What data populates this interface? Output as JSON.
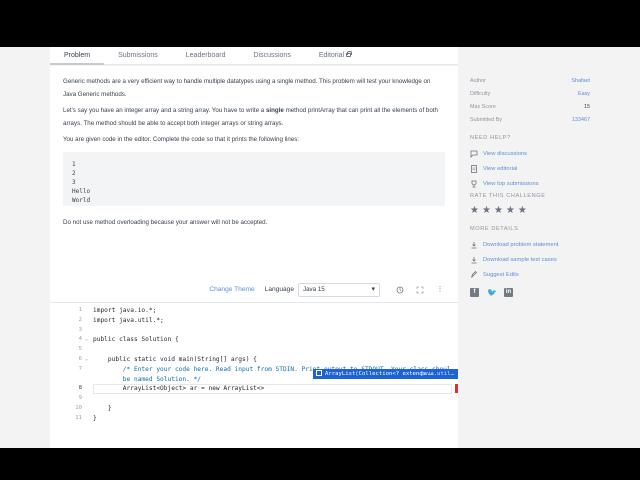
{
  "tabs": [
    {
      "label": "Problem"
    },
    {
      "label": "Submissions"
    },
    {
      "label": "Leaderboard"
    },
    {
      "label": "Discussions"
    },
    {
      "label": "Editorial"
    }
  ],
  "problem": {
    "para1": "Generic methods are a very efficient way to handle multiple datatypes using a single method. This problem will test your knowledge on Java Generic methods.",
    "para2_a": "Let's say you have an integer array and a string array. You have to write a ",
    "para2_b": "single",
    "para2_c": " method printArray that can print all the elements of both arrays. The method should be able to accept both integer arrays or string arrays.",
    "para3": "You are given code in the editor. Complete the code so that it prints the following lines:",
    "sample_lines": [
      "1",
      "2",
      "3",
      "Hello",
      "World"
    ],
    "para4": "Do not use method overloading because your answer will not be accepted."
  },
  "sidebar": {
    "meta": [
      {
        "key": "Author",
        "value": "Shafaet"
      },
      {
        "key": "Difficulty",
        "value": "Easy"
      },
      {
        "key": "Max Score",
        "value": "15"
      },
      {
        "key": "Submitted By",
        "value": "133467"
      }
    ],
    "need_help": "NEED HELP?",
    "help_links": [
      {
        "label": "View discussions",
        "icon": "chat-icon"
      },
      {
        "label": "View editorial",
        "icon": "document-icon"
      },
      {
        "label": "View top submissions",
        "icon": "trophy-icon"
      }
    ],
    "rate_label": "RATE THIS CHALLENGE",
    "rating": 5,
    "more_details": "MORE DETAILS",
    "detail_links": [
      {
        "label": "Download problem statement",
        "icon": "download-icon"
      },
      {
        "label": "Download sample test cases",
        "icon": "download-icon"
      },
      {
        "label": "Suggest Edits",
        "icon": "pencil-icon"
      }
    ],
    "social": [
      "facebook-icon",
      "twitter-icon",
      "linkedin-icon"
    ]
  },
  "editor": {
    "change_theme": "Change Theme",
    "language_label": "Language",
    "language_value": "Java 15",
    "lines": [
      {
        "n": "1",
        "text": "import java.io.*;"
      },
      {
        "n": "2",
        "text": "import java.util.*;"
      },
      {
        "n": "3",
        "text": ""
      },
      {
        "n": "4",
        "text": "public class Solution {"
      },
      {
        "n": "5",
        "text": ""
      },
      {
        "n": "6",
        "text": "    public static void main(String[] args) {"
      },
      {
        "n": "7",
        "text": "        /* Enter your code here. Read input from STDIN. Print output to STDOUT. Your class shoul"
      },
      {
        "n": "",
        "text": "        be named Solution. */"
      },
      {
        "n": "8",
        "text": "        ArrayList<Object> ar = new ArrayList<>"
      },
      {
        "n": "9",
        "text": ""
      },
      {
        "n": "10",
        "text": "    }"
      },
      {
        "n": "11",
        "text": "}"
      }
    ],
    "autocomplete_text": "ArrayList(Collection<? extends …",
    "autocomplete_type": "java.util…"
  },
  "colors": {
    "accent": "#5b8fd6",
    "autocomplete": "#1e63d6",
    "error": "#e02f2f"
  }
}
